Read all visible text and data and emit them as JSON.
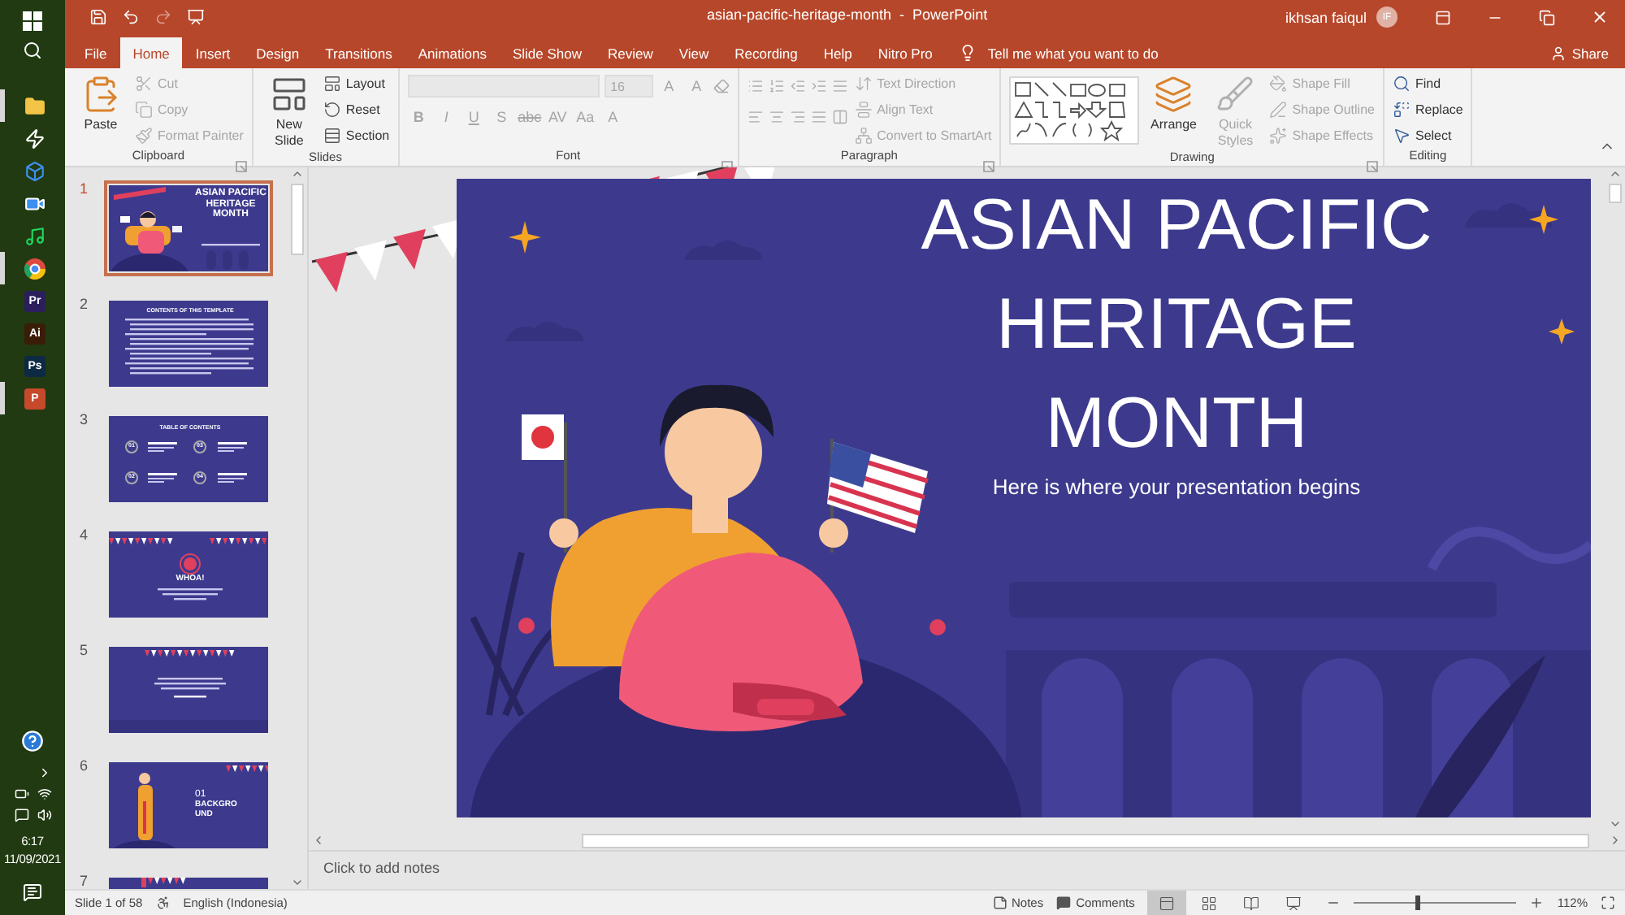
{
  "taskbar": {
    "apps": [
      {
        "kind": "explorer",
        "active": true
      },
      {
        "kind": "bolt",
        "active": false
      },
      {
        "kind": "dropbox",
        "active": false
      },
      {
        "kind": "video",
        "active": false
      },
      {
        "kind": "music",
        "active": false
      },
      {
        "kind": "browser",
        "active": true
      },
      {
        "kind": "logo",
        "label": "Pr",
        "color": "#2a1f5c",
        "active": false
      },
      {
        "kind": "logo",
        "label": "Ai",
        "color": "#3a1d08",
        "active": false
      },
      {
        "kind": "logo",
        "label": "Ps",
        "color": "#0d2a45",
        "active": false
      },
      {
        "kind": "logo",
        "label": "P",
        "color": "#c5492a",
        "active": true
      }
    ],
    "time": "6:17",
    "date": "11/09/2021"
  },
  "quick_access": [
    {
      "kind": "save",
      "disabled": false
    },
    {
      "kind": "undo",
      "disabled": false
    },
    {
      "kind": "redo",
      "disabled": true
    },
    {
      "kind": "present",
      "disabled": false
    }
  ],
  "window": {
    "title": "asian-pacific-heritage-month  -  PowerPoint",
    "user": "ikhsan faiqul",
    "initials": "IF"
  },
  "tabs": [
    {
      "label": "File",
      "selected": false
    },
    {
      "label": "Home",
      "selected": true
    },
    {
      "label": "Insert",
      "selected": false
    },
    {
      "label": "Design",
      "selected": false
    },
    {
      "label": "Transitions",
      "selected": false
    },
    {
      "label": "Animations",
      "selected": false
    },
    {
      "label": "Slide Show",
      "selected": false
    },
    {
      "label": "Review",
      "selected": false
    },
    {
      "label": "View",
      "selected": false
    },
    {
      "label": "Recording",
      "selected": false
    },
    {
      "label": "Help",
      "selected": false
    },
    {
      "label": "Nitro Pro",
      "selected": false
    }
  ],
  "tell_me": {
    "placeholder": "Tell me what you want to do"
  },
  "share": "Share",
  "ribbon": [
    {
      "kind": "buttons",
      "label": "Clipboard",
      "launcher": true,
      "items": [
        {
          "kind": "large",
          "label": "Paste",
          "disabled": false
        },
        {
          "kind": "small",
          "label": "Cut",
          "disabled": true
        },
        {
          "kind": "small",
          "label": "Copy",
          "disabled": true
        },
        {
          "kind": "small",
          "label": "Format Painter",
          "disabled": true
        }
      ]
    },
    {
      "kind": "buttons",
      "label": "Slides",
      "launcher": false,
      "items": [
        {
          "kind": "large",
          "label": "New Slide",
          "disabled": false
        },
        {
          "kind": "small",
          "label": "Layout",
          "disabled": false
        },
        {
          "kind": "small",
          "label": "Reset",
          "disabled": false
        },
        {
          "kind": "small",
          "label": "Section",
          "disabled": false
        }
      ]
    },
    {
      "kind": "font",
      "label": "Font",
      "launcher": true,
      "disabled": true,
      "size": "16",
      "row1": [
        "A",
        "A"
      ],
      "row2": [
        "B",
        "I",
        "U",
        "S",
        "abc",
        "AV",
        "Aa",
        "A"
      ]
    },
    {
      "kind": "paragraph",
      "label": "Paragraph",
      "launcher": true,
      "items": [
        {
          "kind": "small",
          "label": "Text Direction",
          "disabled": true
        },
        {
          "kind": "small",
          "label": "Align Text",
          "disabled": true
        },
        {
          "kind": "small",
          "label": "Convert to SmartArt",
          "disabled": true
        }
      ]
    },
    {
      "kind": "drawing",
      "label": "Drawing",
      "launcher": true,
      "items": [
        {
          "kind": "large",
          "label": "Arrange",
          "disabled": false
        },
        {
          "kind": "large",
          "label": "Quick Styles",
          "disabled": true
        },
        {
          "kind": "small",
          "label": "Shape Fill",
          "disabled": true
        },
        {
          "kind": "small",
          "label": "Shape Outline",
          "disabled": true
        },
        {
          "kind": "small",
          "label": "Shape Effects",
          "disabled": true
        }
      ]
    },
    {
      "kind": "buttons",
      "label": "Editing",
      "launcher": false,
      "items": [
        {
          "kind": "small",
          "label": "Find",
          "disabled": false
        },
        {
          "kind": "small",
          "label": "Replace",
          "disabled": false
        },
        {
          "kind": "small",
          "label": "Select",
          "disabled": false
        }
      ]
    }
  ],
  "slides": [
    {
      "number": "1",
      "selected": true,
      "kind": "title",
      "title": "ASIAN PACIFIC HERITAGE MONTH"
    },
    {
      "number": "2",
      "selected": false,
      "kind": "text",
      "title": "CONTENTS OF THIS TEMPLATE"
    },
    {
      "number": "3",
      "selected": false,
      "kind": "toc",
      "title": "TABLE OF CONTENTS",
      "items": [
        "01",
        "03",
        "02",
        "04"
      ]
    },
    {
      "number": "4",
      "selected": false,
      "kind": "whoa",
      "title": "WHOA!"
    },
    {
      "number": "5",
      "selected": false,
      "kind": "quote"
    },
    {
      "number": "6",
      "selected": false,
      "kind": "section",
      "index": "01",
      "title": "BACKGROUND"
    },
    {
      "number": "7",
      "selected": false,
      "kind": "partial"
    }
  ],
  "slide": {
    "title": "ASIAN PACIFIC HERITAGE MONTH",
    "subtitle": "Here is where your presentation begins"
  },
  "notes": {
    "placeholder": "Click to add notes"
  },
  "status_bar": {
    "slide": "Slide 1 of 58",
    "language": "English (Indonesia)",
    "notes": "Notes",
    "comments": "Comments",
    "views": [
      {
        "kind": "normal",
        "selected": true
      },
      {
        "kind": "sorter",
        "selected": false
      },
      {
        "kind": "reading",
        "selected": false
      },
      {
        "kind": "slideshow",
        "selected": false
      }
    ],
    "zoom": {
      "level": 0.38,
      "reading": "112%"
    }
  }
}
